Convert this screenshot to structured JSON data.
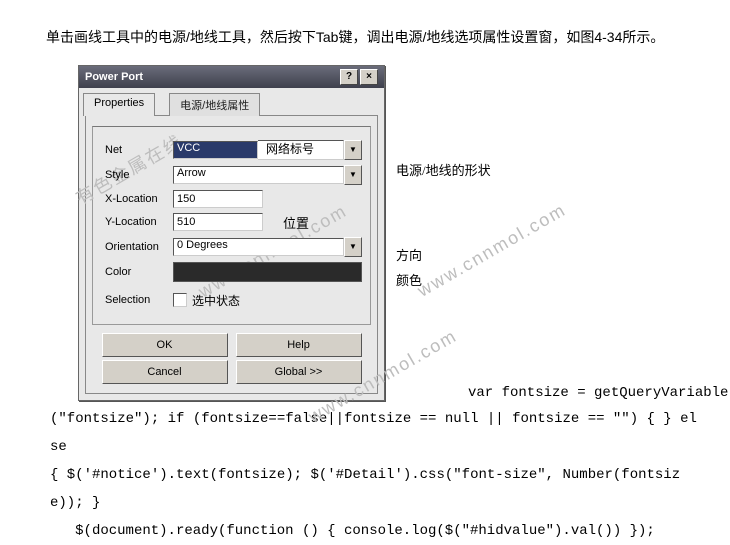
{
  "intro": "　　单击画线工具中的电源/地线工具，然后按下Tab键，调出电源/地线选项属性设置窗，如图4-34所示。",
  "dialog": {
    "title": "Power Port",
    "help_btn": "?",
    "close_btn": "×",
    "tabs": {
      "active": "Properties",
      "inactive": "电源/地线属性"
    },
    "fields": {
      "net_label": "Net",
      "net_value": "VCC",
      "net_annot": "网络标号",
      "style_label": "Style",
      "style_value": "Arrow",
      "style_annot": "电源/地线的形状",
      "xloc_label": "X-Location",
      "xloc_value": "150",
      "yloc_label": "Y-Location",
      "yloc_value": "510",
      "loc_annot": "位置",
      "orient_label": "Orientation",
      "orient_value": "0 Degrees",
      "orient_annot": "方向",
      "color_label": "Color",
      "color_annot": "颜色",
      "sel_label": "Selection",
      "sel_annot": "选中状态"
    },
    "buttons": {
      "ok": "OK",
      "help": "Help",
      "cancel": "Cancel",
      "global": "Global >>"
    }
  },
  "watermark": "www.cnnmol.com",
  "watermark_cn": "有色金属在线",
  "code": {
    "l1a": "var fontsize = getQueryVariable",
    "l2": "(\"fontsize\"); if (fontsize==false||fontsize == null || fontsize == \"\") { } else",
    "l3": "{ $('#notice').text(fontsize); $('#Detail').css(\"font-size\", Number(fontsize)); }",
    "l4": "$(document).ready(function () { console.log($(\"#hidvalue\").val()) });"
  }
}
